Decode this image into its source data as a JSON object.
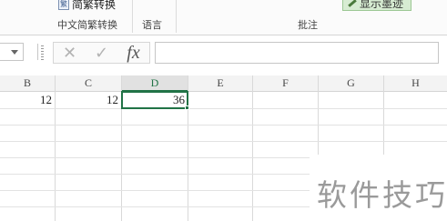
{
  "ribbon": {
    "convert_button": "简繁转换",
    "group_chinese_conversion": "中文简繁转换",
    "group_language": "语言",
    "group_comments": "批注",
    "show_ink_button": "显示墨迹"
  },
  "formula_bar": {
    "cancel_glyph": "✕",
    "enter_glyph": "✓",
    "function_glyph": "fx",
    "formula_value": ""
  },
  "columns": [
    "B",
    "C",
    "D",
    "E",
    "F",
    "G",
    "H"
  ],
  "selected_column": "D",
  "cells": {
    "B1": "12",
    "C1": "12",
    "D1": "36"
  },
  "active_cell": "D1",
  "watermark": "软件技巧"
}
